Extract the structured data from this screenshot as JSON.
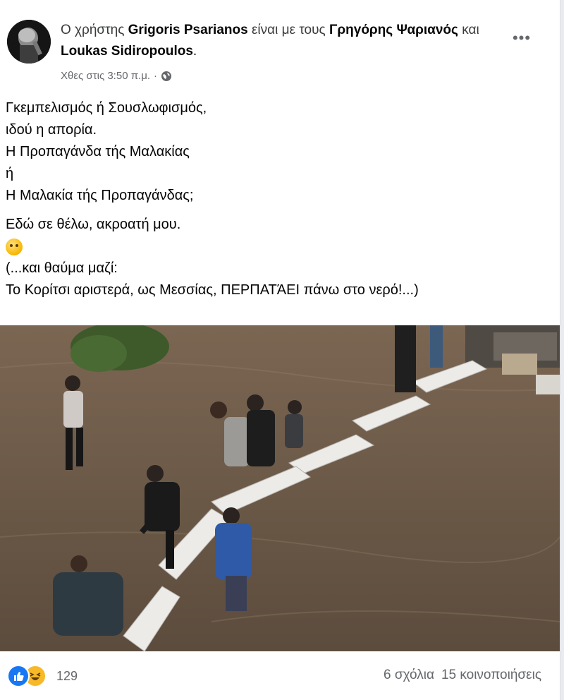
{
  "post": {
    "header": {
      "prefix": "Ο χρήστης",
      "author": "Grigoris Psarianos",
      "with_text": "είναι με τους",
      "tagged_1": "Γρηγόρης Ψαριανός",
      "and_text": "και",
      "tagged_2": "Loukas Sidiropoulos",
      "end": "."
    },
    "timestamp": "Χθες στις 3:50 π.μ.",
    "separator": "·",
    "privacy_icon": "globe-icon",
    "more_label": "•••",
    "lines": [
      "Γκεμπελισμός ή Σουσλωφισμός,",
      "ιδού η απορία.",
      "Η Προπαγάνδα τής Μαλακίας",
      "ή",
      "Η Μαλακία τής Προπαγάνδας;",
      "Εδώ σε θέλω, ακροατή μου.",
      "(...και θαύμα μαζί:",
      "Το Κορίτσι αριστερά, ως Μεσσίας, ΠΕΡΠΑΤΆΕΙ πάνω στο νερό!...)"
    ],
    "emoji": "thinking-face-emoji"
  },
  "footer": {
    "reaction_icons": [
      "like-icon",
      "haha-icon"
    ],
    "reaction_count": "129",
    "comments": "6 σχόλια",
    "shares": "15 κοινοποιήσεις"
  },
  "colors": {
    "text": "#050505",
    "muted": "#65676b",
    "like_blue": "#1877f2",
    "haha_yellow": "#f7b928",
    "water": "#6b5a48"
  }
}
